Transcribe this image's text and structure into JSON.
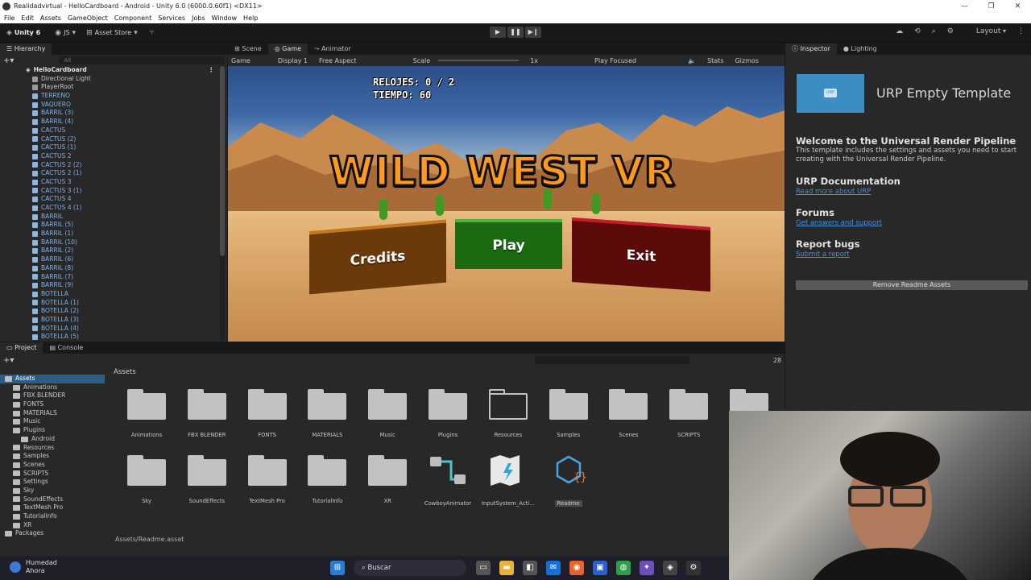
{
  "window": {
    "title": "Realidadvirtual - HelloCardboard - Android - Unity 6.0 (6000.0.60f1) <DX11>",
    "controls": [
      "—",
      "❐",
      "✕"
    ]
  },
  "menu": [
    "File",
    "Edit",
    "Assets",
    "GameObject",
    "Component",
    "Services",
    "Jobs",
    "Window",
    "Help"
  ],
  "toolbar": {
    "unity_label": "Unity 6",
    "account": "JS",
    "asset_store": "Asset Store",
    "layout": "Layout"
  },
  "hierarchy": {
    "tab": "Hierarchy",
    "search_placeholder": "All",
    "scene": "HelloCardboard",
    "items": [
      {
        "label": "Directional Light",
        "kind": "plain"
      },
      {
        "label": "PlayerRoot",
        "kind": "plain"
      },
      {
        "label": "TERRENO",
        "kind": "prefab"
      },
      {
        "label": "VAQUERO",
        "kind": "prefab"
      },
      {
        "label": "BARRIL (3)",
        "kind": "prefab"
      },
      {
        "label": "BARRIL (4)",
        "kind": "prefab"
      },
      {
        "label": "CACTUS",
        "kind": "prefab"
      },
      {
        "label": "CACTUS (2)",
        "kind": "prefab"
      },
      {
        "label": "CACTUS (1)",
        "kind": "prefab"
      },
      {
        "label": "CACTUS 2",
        "kind": "prefab"
      },
      {
        "label": "CACTUS 2 (2)",
        "kind": "prefab"
      },
      {
        "label": "CACTUS 2 (1)",
        "kind": "prefab"
      },
      {
        "label": "CACTUS 3",
        "kind": "prefab"
      },
      {
        "label": "CACTUS 3 (1)",
        "kind": "prefab"
      },
      {
        "label": "CACTUS 4",
        "kind": "prefab"
      },
      {
        "label": "CACTUS 4 (1)",
        "kind": "prefab"
      },
      {
        "label": "BARRIL",
        "kind": "prefab"
      },
      {
        "label": "BARRIL (5)",
        "kind": "prefab"
      },
      {
        "label": "BARRIL (1)",
        "kind": "prefab"
      },
      {
        "label": "BARRIL (10)",
        "kind": "prefab"
      },
      {
        "label": "BARRIL (2)",
        "kind": "prefab"
      },
      {
        "label": "BARRIL (6)",
        "kind": "prefab"
      },
      {
        "label": "BARRIL (8)",
        "kind": "prefab"
      },
      {
        "label": "BARRIL (7)",
        "kind": "prefab"
      },
      {
        "label": "BARRIL (9)",
        "kind": "prefab"
      },
      {
        "label": "BOTELLA",
        "kind": "prefab"
      },
      {
        "label": "BOTELLA (1)",
        "kind": "prefab"
      },
      {
        "label": "BOTELLA (2)",
        "kind": "prefab"
      },
      {
        "label": "BOTELLA (3)",
        "kind": "prefab"
      },
      {
        "label": "BOTELLA (4)",
        "kind": "prefab"
      },
      {
        "label": "BOTELLA (5)",
        "kind": "prefab"
      }
    ]
  },
  "center_tabs": [
    "Scene",
    "Game",
    "Animator"
  ],
  "game_toolbar": {
    "mode": "Game",
    "display": "Display 1",
    "aspect": "Free Aspect",
    "scale_label": "Scale",
    "scale_value": "1x",
    "play_mode": "Play Focused",
    "stats": "Stats",
    "gizmos": "Gizmos"
  },
  "game": {
    "hud_line1": "RELOJES: 0 / 2",
    "hud_line2": "TIEMPO: 60",
    "title": "WILD WEST VR",
    "btn_credits": "Credits",
    "btn_play": "Play",
    "btn_exit": "Exit"
  },
  "inspector": {
    "tabs": [
      "Inspector",
      "Lighting"
    ],
    "thumb_label": "URP",
    "title": "URP Empty Template",
    "welcome_h": "Welcome to the Universal Render Pipeline",
    "welcome_p": "This template includes the settings and assets you need to start creating with the Universal Render Pipeline.",
    "doc_h": "URP Documentation",
    "doc_link": "Read more about URP",
    "forums_h": "Forums",
    "forums_link": "Get answers and support",
    "bugs_h": "Report bugs",
    "bugs_link": "Submit a report",
    "remove_btn": "Remove Readme Assets"
  },
  "project": {
    "tabs": [
      "Project",
      "Console"
    ],
    "count": "28",
    "tree": [
      {
        "label": "Assets",
        "indent": 0,
        "selected": true
      },
      {
        "label": "Animations",
        "indent": 1
      },
      {
        "label": "FBX BLENDER",
        "indent": 1
      },
      {
        "label": "FONTS",
        "indent": 1
      },
      {
        "label": "MATERIALS",
        "indent": 1
      },
      {
        "label": "Music",
        "indent": 1
      },
      {
        "label": "Plugins",
        "indent": 1
      },
      {
        "label": "Android",
        "indent": 2
      },
      {
        "label": "Resources",
        "indent": 1
      },
      {
        "label": "Samples",
        "indent": 1
      },
      {
        "label": "Scenes",
        "indent": 1
      },
      {
        "label": "SCRIPTS",
        "indent": 1
      },
      {
        "label": "Settings",
        "indent": 1
      },
      {
        "label": "Sky",
        "indent": 1
      },
      {
        "label": "SoundEffects",
        "indent": 1
      },
      {
        "label": "TextMesh Pro",
        "indent": 1
      },
      {
        "label": "TutorialInfo",
        "indent": 1
      },
      {
        "label": "XR",
        "indent": 1
      },
      {
        "label": "Packages",
        "indent": 0
      }
    ],
    "grid_header": "Assets",
    "assets": [
      {
        "label": "Animations",
        "type": "folder"
      },
      {
        "label": "FBX BLENDER",
        "type": "folder"
      },
      {
        "label": "FONTS",
        "type": "folder"
      },
      {
        "label": "MATERIALS",
        "type": "folder"
      },
      {
        "label": "Music",
        "type": "folder"
      },
      {
        "label": "Plugins",
        "type": "folder"
      },
      {
        "label": "Resources",
        "type": "folder-outline"
      },
      {
        "label": "Samples",
        "type": "folder"
      },
      {
        "label": "Scenes",
        "type": "folder"
      },
      {
        "label": "SCRIPTS",
        "type": "folder"
      },
      {
        "label": "",
        "type": "folder"
      },
      {
        "label": "Sky",
        "type": "folder"
      },
      {
        "label": "SoundEffects",
        "type": "folder"
      },
      {
        "label": "TextMesh Pro",
        "type": "folder"
      },
      {
        "label": "TutorialInfo",
        "type": "folder"
      },
      {
        "label": "XR",
        "type": "folder"
      },
      {
        "label": "CowboyAnimator",
        "type": "animator"
      },
      {
        "label": "InputSystem_Acti...",
        "type": "input"
      },
      {
        "label": "Readme",
        "type": "readme",
        "selected": true
      }
    ],
    "status_path": "Assets/Readme.asset"
  },
  "taskbar": {
    "weather_title": "Humedad",
    "weather_sub": "Ahora",
    "search_placeholder": "Buscar"
  }
}
